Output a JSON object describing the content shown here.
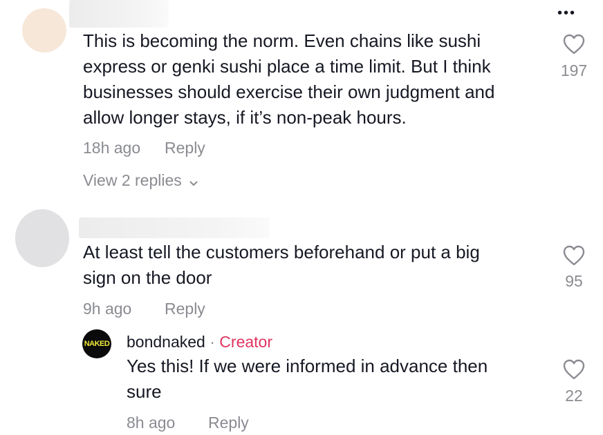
{
  "comments": [
    {
      "text": "This is becoming the norm. Even chains like sushi express or genki sushi place a time limit. But I think businesses should exercise their own judgment and allow longer stays, if it’s non-peak hours.",
      "lines": [
        "This is becoming the norm. Even chains like sushi",
        "express or genki sushi place a time limit. But I think",
        "businesses should exercise their own judgment and",
        "allow longer stays, if it’s non-peak hours."
      ],
      "time": "18h ago",
      "reply_label": "Reply",
      "likes": "197",
      "view_replies": "View 2 replies",
      "avatar_color": "#f6e7d8"
    },
    {
      "lines": [
        "At least tell the customers beforehand or put a big",
        "sign on the door"
      ],
      "time": "9h ago",
      "reply_label": "Reply",
      "likes": "95",
      "avatar_color": "#e1e1e3"
    }
  ],
  "reply": {
    "author": "bondnaked",
    "separator": "·",
    "badge": "Creator",
    "logo_text": "NAKED",
    "lines": [
      "Yes this! If we were informed in advance then",
      "sure"
    ],
    "time": "8h ago",
    "reply_label": "Reply",
    "likes": "22"
  },
  "more_menu": "•••",
  "colors": {
    "creator": "#e0345f",
    "meta": "#8a8b91",
    "text": "#161823"
  }
}
